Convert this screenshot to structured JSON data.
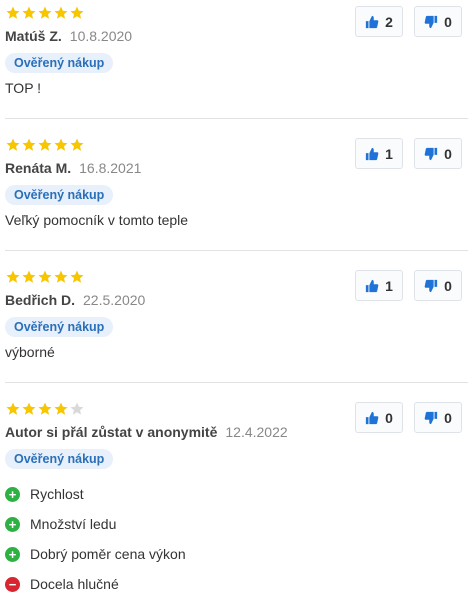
{
  "colors": {
    "star_filled": "#f7c600",
    "star_empty": "#d9d9d9",
    "thumb_blue": "#1f73d6",
    "pro_green": "#2eb142",
    "con_red": "#d7262f",
    "badge_text": "#2a6fb8"
  },
  "reviews": [
    {
      "rating": 5,
      "author": "Matúš Z.",
      "date": "10.8.2020",
      "badge": "Ověřený nákup",
      "text": "TOP !",
      "likes": "2",
      "dislikes": "0"
    },
    {
      "rating": 5,
      "author": "Renáta M.",
      "date": "16.8.2021",
      "badge": "Ověřený nákup",
      "text": "Veľký pomocník v tomto teple",
      "likes": "1",
      "dislikes": "0"
    },
    {
      "rating": 5,
      "author": "Bedřich D.",
      "date": "22.5.2020",
      "badge": "Ověřený nákup",
      "text": "výborné",
      "likes": "1",
      "dislikes": "0"
    },
    {
      "rating": 4,
      "author": "Autor si přál zůstat v anonymitě",
      "date": "12.4.2022",
      "badge": "Ověřený nákup",
      "likes": "0",
      "dislikes": "0",
      "pros": [
        "Rychlost",
        "Množství ledu",
        "Dobrý poměr cena výkon"
      ],
      "cons": [
        "Docela hlučné"
      ],
      "pro_symbol": "+",
      "con_symbol": "−"
    }
  ]
}
